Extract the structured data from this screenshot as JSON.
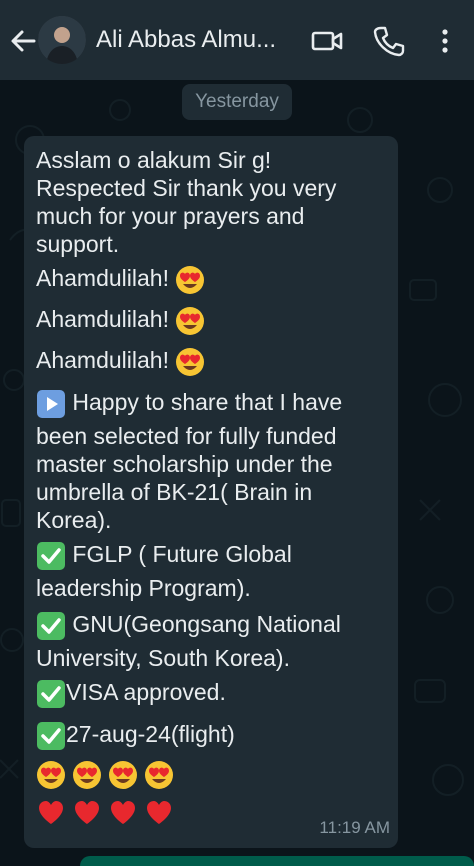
{
  "header": {
    "contact_name": "Ali Abbas Almu..."
  },
  "date_divider": "Yesterday",
  "message": {
    "lines": [
      "Asslam o alakum Sir g!",
      "Respected Sir thank you very",
      "much for your prayers and",
      "support.",
      "Ahamdulilah!",
      "Ahamdulilah!",
      "Ahamdulilah!",
      "Happy to share that I have",
      "been selected for fully funded",
      "master scholarship under the",
      "umbrella of BK-21( Brain in",
      "Korea).",
      "FGLP ( Future Global",
      "leadership Program).",
      "GNU(Geongsang National",
      "University, South Korea).",
      "VISA approved.",
      "27-aug-24(flight)"
    ],
    "time": "11:19 AM"
  },
  "icons": {
    "back": "back-arrow-icon",
    "video": "video-call-icon",
    "call": "phone-call-icon",
    "menu": "more-options-icon"
  },
  "colors": {
    "header_bg": "#1f2c34",
    "chat_bg": "#0b141a",
    "bubble_bg": "#1f2c34",
    "text": "#e9edef",
    "meta_text": "#8696a0"
  }
}
